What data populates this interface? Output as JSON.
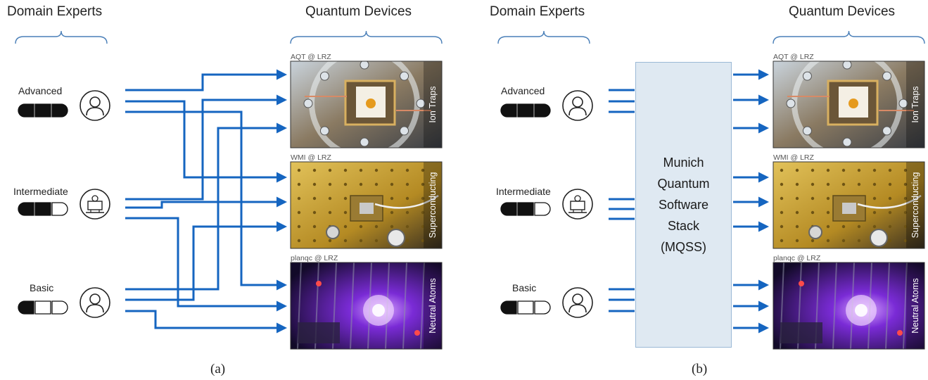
{
  "panel_a": {
    "left_header": "Domain Experts",
    "right_header": "Quantum Devices",
    "caption": "(a)"
  },
  "panel_b": {
    "left_header": "Domain Experts",
    "right_header": "Quantum Devices",
    "caption": "(b)",
    "middleware": {
      "lines": [
        "Munich",
        "Quantum",
        "Software",
        "Stack",
        "(MQSS)"
      ]
    }
  },
  "levels": [
    {
      "label": "Advanced",
      "filled": 3,
      "icon": "person-icon"
    },
    {
      "label": "Intermediate",
      "filled": 2,
      "icon": "computer-icon"
    },
    {
      "label": "Basic",
      "filled": 1,
      "icon": "person-icon"
    }
  ],
  "devices": [
    {
      "source": "AQT @ LRZ",
      "name": "Ion Traps",
      "theme": "ion-traps"
    },
    {
      "source": "WMI @ LRZ",
      "name": "Superconducting",
      "theme": "superconducting"
    },
    {
      "source": "planqc @ LRZ",
      "name": "Neutral Atoms",
      "theme": "neutral-atoms"
    }
  ],
  "colors": {
    "arrow": "#1565c0",
    "box_fill": "#dfe9f2",
    "box_border": "#9bb9d6",
    "bracket": "#4a7fb8"
  }
}
